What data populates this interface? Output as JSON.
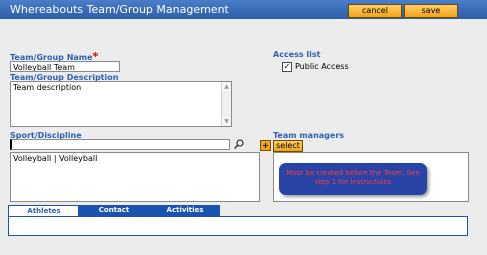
{
  "window": {
    "title": "Whereabouts Team/Group Management"
  },
  "toolbar": {
    "cancel_label": "cancel",
    "save_label": "save"
  },
  "form": {
    "name_label": "Team/Group Name",
    "required_mark": "*",
    "name_value": "Volleyball Team",
    "description_label": "Team/Group Description",
    "description_value": "Team description",
    "sport_label": "Sport/Discipline",
    "sport_search_value": "",
    "sport_add_label": "+",
    "sport_selected": [
      "Volleyball | Volleyball"
    ]
  },
  "access": {
    "label": "Access list",
    "public_checked": true,
    "public_label": "Public Access"
  },
  "managers": {
    "label": "Team managers",
    "select_label": "select",
    "tooltip_line1": "Must be created before the Team. See",
    "tooltip_line2": "step 1 for instructions"
  },
  "tabs": [
    "Athletes",
    "Contact",
    "Activities"
  ],
  "icons": {
    "search": "magnifier-icon",
    "checkbox": "check-icon"
  }
}
